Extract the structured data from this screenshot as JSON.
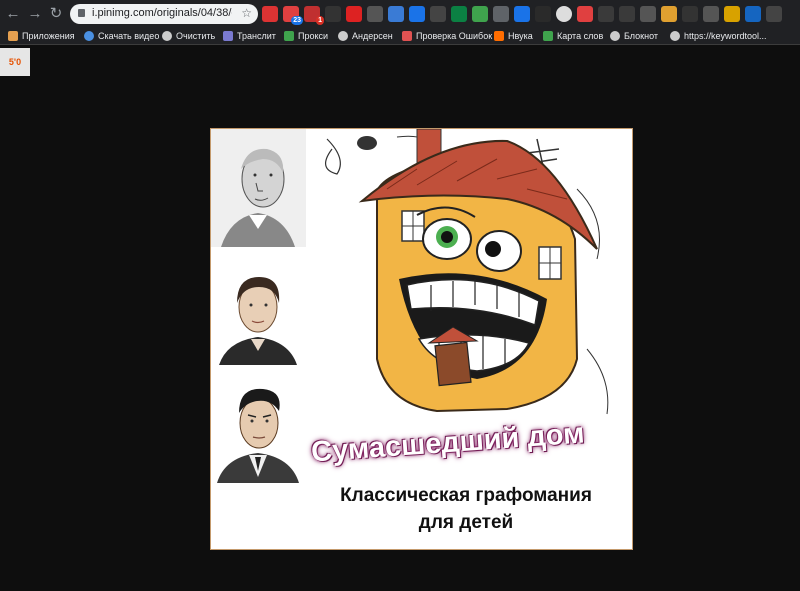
{
  "toolbar": {
    "url": "i.pinimg.com/originals/04/38/cd...",
    "back_icon": "arrow-left-icon",
    "forward_icon": "arrow-right-icon",
    "reload_icon": "reload-icon",
    "ext_badges": {
      "b1": "23",
      "b2": "1"
    }
  },
  "bookmarks": [
    {
      "label": "Приложения",
      "icon": "apps-grid-icon",
      "color": "#e5a050"
    },
    {
      "label": "Скачать видео",
      "icon": "download-video-icon",
      "color": "#4a90e2"
    },
    {
      "label": "Очистить",
      "icon": "gear-icon",
      "color": "#cccccc"
    },
    {
      "label": "Транслит",
      "icon": "translit-icon",
      "color": "#7a7ad0"
    },
    {
      "label": "Прокси",
      "icon": "shield-icon",
      "color": "#3fa34d"
    },
    {
      "label": "Андерсен",
      "icon": "globe-icon",
      "color": "#cccccc"
    },
    {
      "label": "Проверка Ошибок",
      "icon": "spellcheck-icon",
      "color": "#e05252"
    },
    {
      "label": "Нвука",
      "icon": "nvuka-icon",
      "color": "#ff6d00"
    },
    {
      "label": "Карта слов",
      "icon": "word-map-icon",
      "color": "#3fa34d"
    },
    {
      "label": "Блокнот",
      "icon": "globe-icon",
      "color": "#cccccc"
    },
    {
      "label": "https://keywordtool...",
      "icon": "globe-icon",
      "color": "#cccccc"
    }
  ],
  "page": {
    "widget_label": "5'0",
    "cover": {
      "title": "Сумасшедший дом",
      "subtitle_line1": "Классическая графомания",
      "subtitle_line2": "для детей"
    }
  }
}
